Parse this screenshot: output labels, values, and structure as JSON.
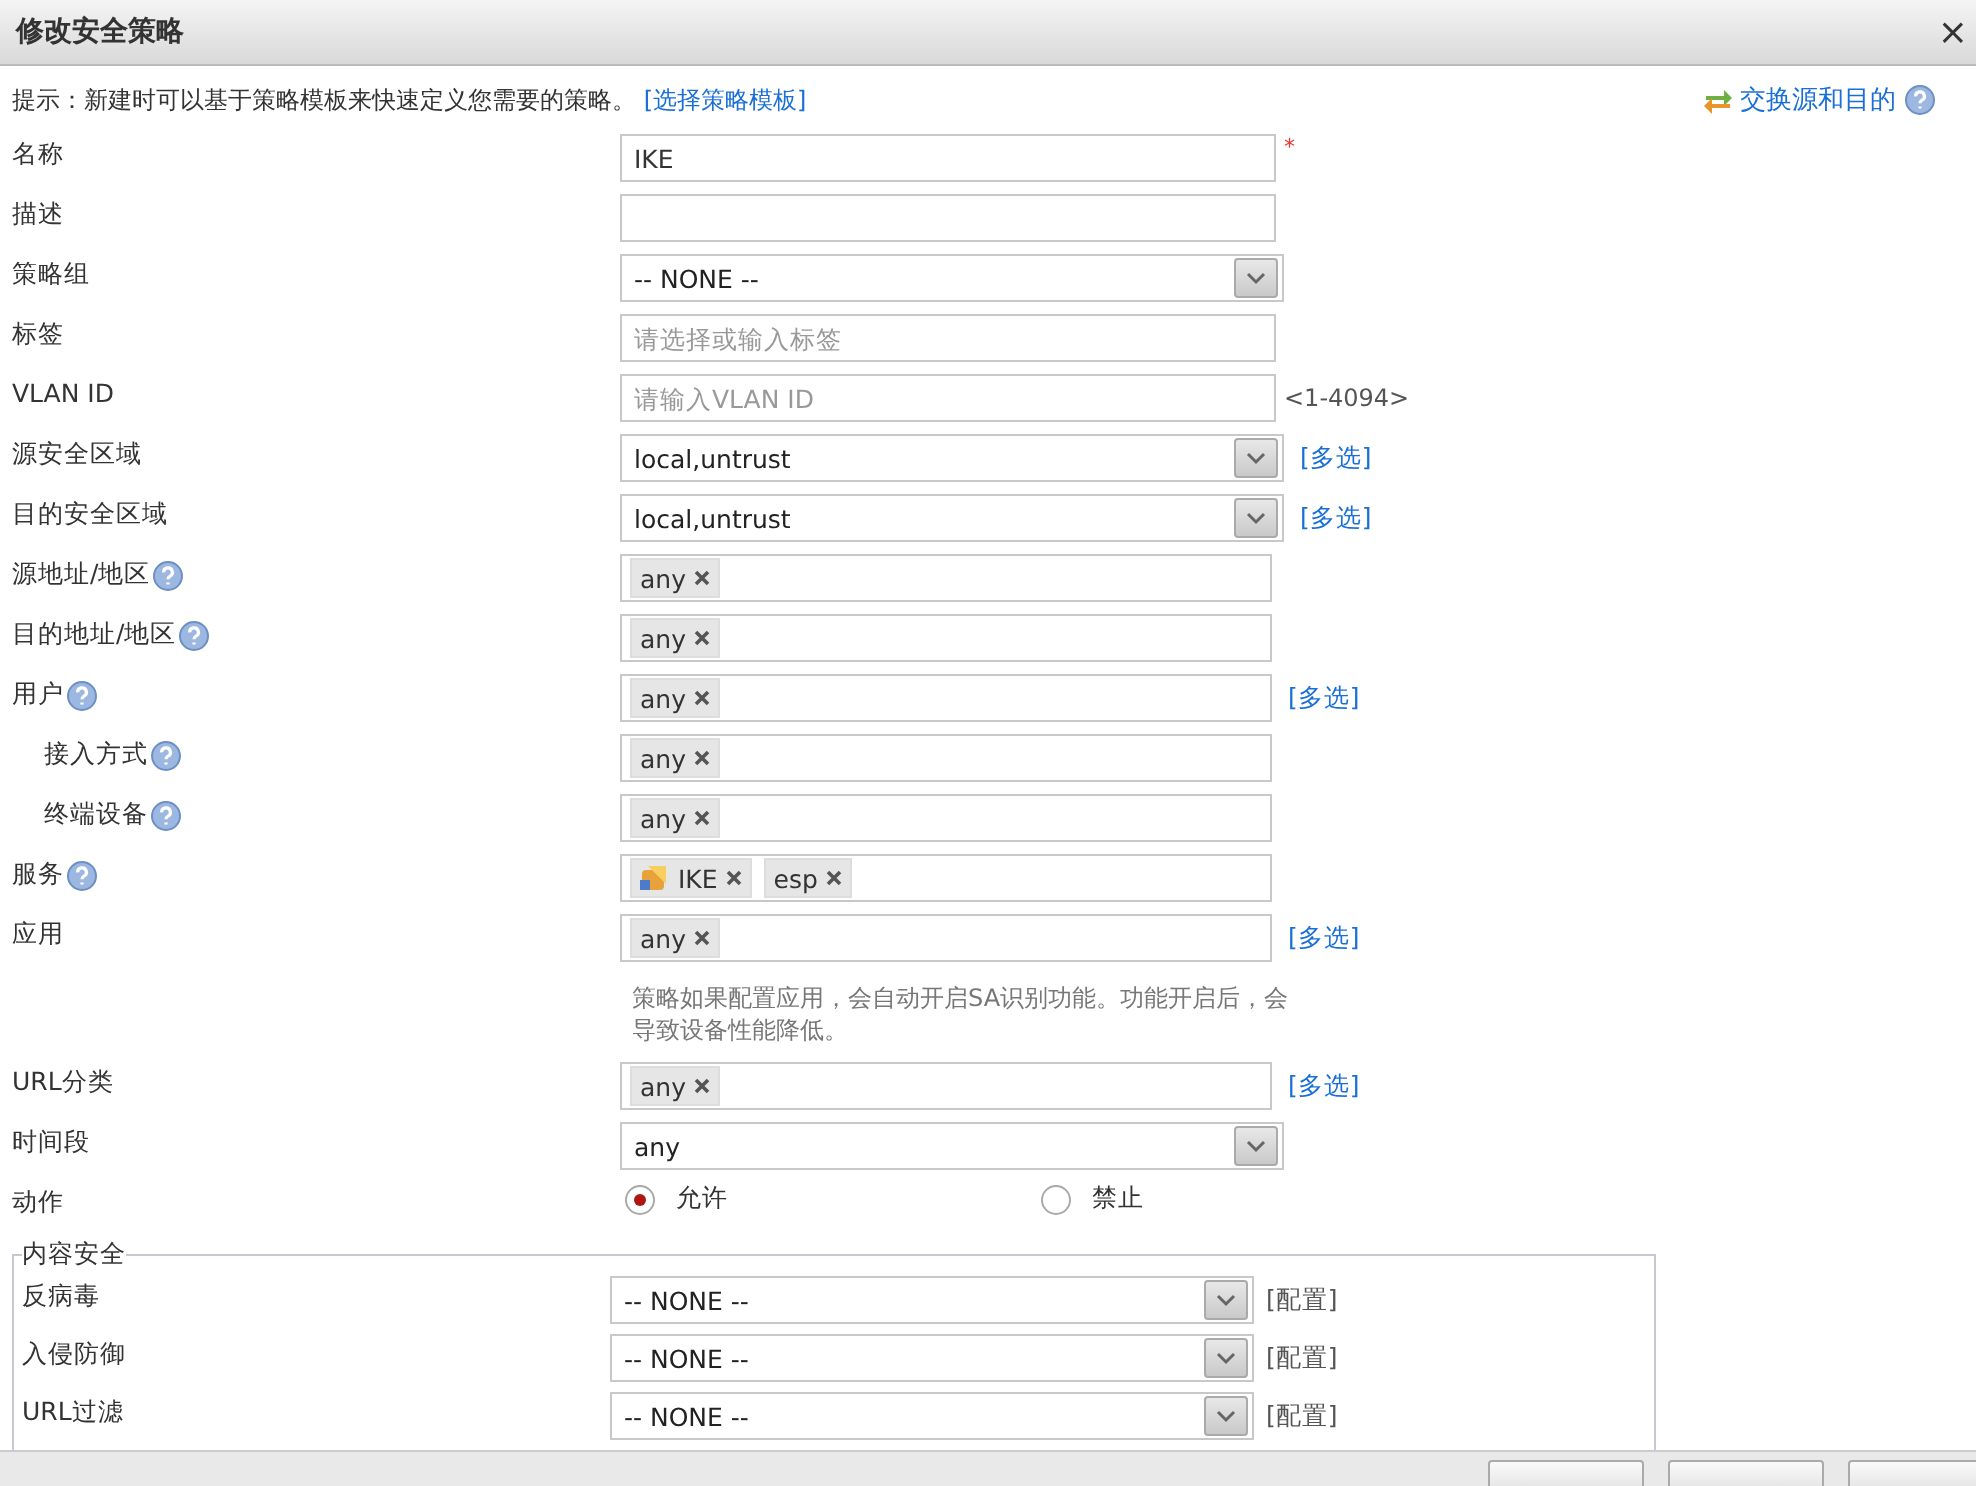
{
  "window": {
    "title": "修改安全策略",
    "close": "×"
  },
  "hint": {
    "text": "提示：新建时可以基于策略模板来快速定义您需要的策略。",
    "link": "[选择策略模板]"
  },
  "swap": {
    "label": "交换源和目的"
  },
  "fields": [
    {
      "kind": "text",
      "label": "名称",
      "value": "IKE",
      "required": "*"
    },
    {
      "kind": "text",
      "label": "描述"
    },
    {
      "kind": "select",
      "label": "策略组",
      "value": "-- NONE --"
    },
    {
      "kind": "text",
      "label": "标签",
      "placeholder": "请选择或输入标签"
    },
    {
      "kind": "text",
      "label": "VLAN ID",
      "placeholder": "请输入VLAN ID",
      "range": "<1-4094>"
    },
    {
      "kind": "select",
      "label": "源安全区域",
      "value": "local,untrust",
      "link": "[多选]"
    },
    {
      "kind": "select",
      "label": "目的安全区域",
      "value": "local,untrust",
      "link": "[多选]"
    },
    {
      "kind": "tags",
      "label": "源地址/地区",
      "help": true,
      "tags": [
        {
          "label": "any",
          "icon": false
        }
      ]
    },
    {
      "kind": "tags",
      "label": "目的地址/地区",
      "help": true,
      "tags": [
        {
          "label": "any",
          "icon": false
        }
      ]
    },
    {
      "kind": "tags",
      "label": "用户",
      "help": true,
      "tags": [
        {
          "label": "any",
          "icon": false
        }
      ],
      "link": "[多选]"
    },
    {
      "kind": "tags",
      "label": "接入方式",
      "help": true,
      "indented": true,
      "tags": [
        {
          "label": "any",
          "icon": false
        }
      ]
    },
    {
      "kind": "tags",
      "label": "终端设备",
      "help": true,
      "indented": true,
      "tags": [
        {
          "label": "any",
          "icon": false
        }
      ]
    },
    {
      "kind": "tags",
      "label": "服务",
      "help": true,
      "tags": [
        {
          "label": "IKE",
          "icon": true
        },
        {
          "label": "esp",
          "icon": false
        }
      ]
    },
    {
      "kind": "tags",
      "label": "应用",
      "tags": [
        {
          "label": "any",
          "icon": false
        }
      ],
      "link": "[多选]",
      "note": "策略如果配置应用，会自动开启SA识别功能。功能开启后，会导致设备性能降低。"
    },
    {
      "kind": "tags",
      "label": "URL分类",
      "tags": [
        {
          "label": "any",
          "icon": false
        }
      ],
      "link": "[多选]"
    },
    {
      "kind": "select",
      "label": "时间段",
      "value": "any"
    },
    {
      "kind": "radio",
      "label": "动作",
      "options": [
        {
          "label": "允许",
          "selected": true
        },
        {
          "label": "禁止",
          "selected": false
        }
      ]
    }
  ],
  "content_security": {
    "legend": "内容安全",
    "rows": [
      {
        "label": "反病毒",
        "value": "-- NONE --",
        "link": "[配置]"
      },
      {
        "label": "入侵防御",
        "value": "-- NONE --",
        "link": "[配置]"
      },
      {
        "label": "URL过滤",
        "value": "-- NONE --",
        "link": "[配置]"
      }
    ]
  }
}
